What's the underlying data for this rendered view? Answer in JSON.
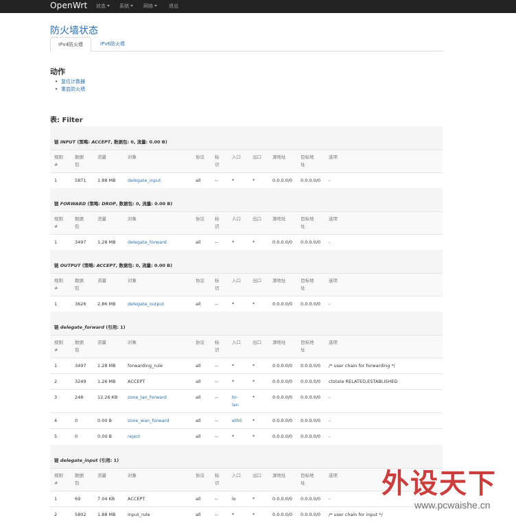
{
  "navbar": {
    "brand": "OpenWrt",
    "menus": [
      "状态",
      "系统",
      "网络"
    ],
    "logout": "退出"
  },
  "page": {
    "title": "防火墙状态",
    "tabs": [
      "IPv4防火墙",
      "IPv6防火墙"
    ]
  },
  "actions": {
    "heading": "动作",
    "items": [
      "复位计数器",
      "重启防火墙"
    ]
  },
  "table_heading": "表: Filter",
  "columns": [
    "规则\n#",
    "数据\n包",
    "流量",
    "对象",
    "协议",
    "标\n识",
    "入口",
    "出口",
    "源地址",
    "目标地\n址",
    "选项"
  ],
  "chains": [
    {
      "prefix": "链 ",
      "name": "INPUT",
      "policy": " (策略: ",
      "policy_value": "ACCEPT",
      "suffix": ", 数据包: 0, 流量: 0.00 B)",
      "rows": [
        [
          "1",
          "5871",
          "1.88 MB",
          "delegate_input",
          "all",
          "--",
          "*",
          "*",
          "0.0.0.0/0",
          "0.0.0.0/0",
          "-"
        ]
      ]
    },
    {
      "prefix": "链 ",
      "name": "FORWARD",
      "policy": " (策略: ",
      "policy_value": "DROP",
      "suffix": ", 数据包: 0, 流量: 0.00 B)",
      "rows": [
        [
          "1",
          "3497",
          "1.28 MB",
          "delegate_forward",
          "all",
          "--",
          "*",
          "*",
          "0.0.0.0/0",
          "0.0.0.0/0",
          "-"
        ]
      ]
    },
    {
      "prefix": "链 ",
      "name": "OUTPUT",
      "policy": " (策略: ",
      "policy_value": "ACCEPT",
      "suffix": ", 数据包: 0, 流量: 0.00 B)",
      "rows": [
        [
          "1",
          "3626",
          "2.86 MB",
          "delegate_output",
          "all",
          "--",
          "*",
          "*",
          "0.0.0.0/0",
          "0.0.0.0/0",
          "-"
        ]
      ]
    },
    {
      "prefix": "链 ",
      "name": "delegate_forward",
      "policy": " (引用: 1)",
      "policy_value": "",
      "suffix": "",
      "rows": [
        [
          "1",
          "3497",
          "1.28 MB",
          "forwarding_rule",
          "all",
          "--",
          "*",
          "*",
          "0.0.0.0/0",
          "0.0.0.0/0",
          "/* user chain for forwarding */"
        ],
        [
          "2",
          "3249",
          "1.26 MB",
          "ACCEPT",
          "all",
          "--",
          "*",
          "*",
          "0.0.0.0/0",
          "0.0.0.0/0",
          "ctstate RELATED,ESTABLISHED"
        ],
        [
          "3",
          "248",
          "12.26 KB",
          "zone_lan_forward",
          "all",
          "--",
          "br-\nlan",
          "*",
          "0.0.0.0/0",
          "0.0.0.0/0",
          "-"
        ],
        [
          "4",
          "0",
          "0.00 B",
          "zone_wan_forward",
          "all",
          "--",
          "eth0",
          "*",
          "0.0.0.0/0",
          "0.0.0.0/0",
          "-"
        ],
        [
          "5",
          "0",
          "0.00 B",
          "reject",
          "all",
          "--",
          "*",
          "*",
          "0.0.0.0/0",
          "0.0.0.0/0",
          "-"
        ]
      ]
    },
    {
      "prefix": "链 ",
      "name": "delegate_input",
      "policy": " (引用: 1)",
      "policy_value": "",
      "suffix": "",
      "rows": [
        [
          "1",
          "69",
          "7.04 KB",
          "ACCEPT",
          "all",
          "--",
          "lo",
          "*",
          "0.0.0.0/0",
          "0.0.0.0/0",
          "-"
        ],
        [
          "2",
          "5802",
          "1.88 MB",
          "input_rule",
          "all",
          "--",
          "*",
          "*",
          "0.0.0.0/0",
          "0.0.0.0/0",
          "/* user chain for input */"
        ]
      ]
    }
  ],
  "watermark": {
    "text": "外设天下",
    "url": "www.pcwaishe.cn"
  },
  "colors": {
    "navbar": "#222222",
    "link": "#2a6faf",
    "watermark": "#c62a2a"
  }
}
